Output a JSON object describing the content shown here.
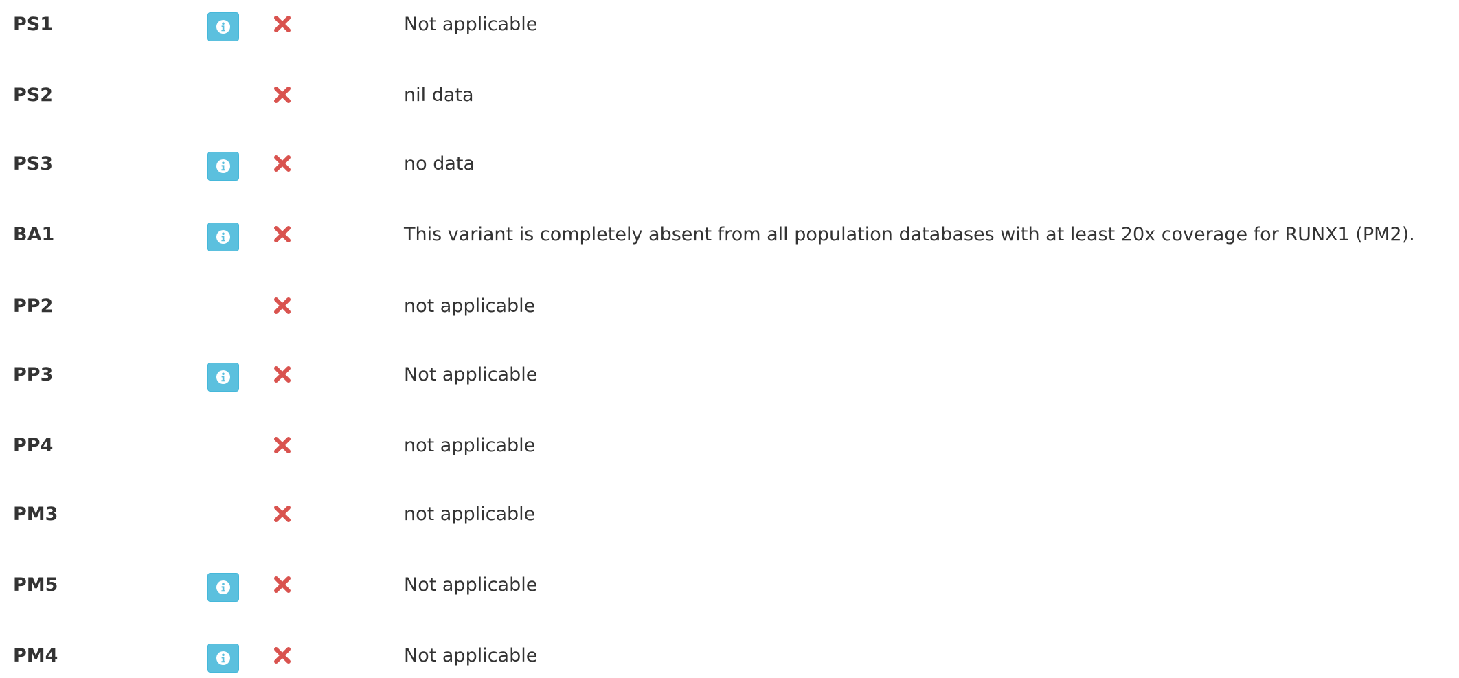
{
  "colors": {
    "text": "#333333",
    "info_button_bg": "#5bc0de",
    "info_button_border": "#46b8da",
    "status_fail": "#d9534f"
  },
  "icons": {
    "info": "info-icon",
    "status": "cross-icon"
  },
  "criteria": [
    {
      "code": "PS1",
      "has_info": true,
      "status": "not-met",
      "comment": "Not applicable"
    },
    {
      "code": "PS2",
      "has_info": false,
      "status": "not-met",
      "comment": "nil data"
    },
    {
      "code": "PS3",
      "has_info": true,
      "status": "not-met",
      "comment": "no data"
    },
    {
      "code": "BA1",
      "has_info": true,
      "status": "not-met",
      "comment": "This variant is completely absent from all population databases with at least 20x coverage for RUNX1 (PM2)."
    },
    {
      "code": "PP2",
      "has_info": false,
      "status": "not-met",
      "comment": "not applicable"
    },
    {
      "code": "PP3",
      "has_info": true,
      "status": "not-met",
      "comment": "Not applicable"
    },
    {
      "code": "PP4",
      "has_info": false,
      "status": "not-met",
      "comment": "not applicable"
    },
    {
      "code": "PM3",
      "has_info": false,
      "status": "not-met",
      "comment": "not applicable"
    },
    {
      "code": "PM5",
      "has_info": true,
      "status": "not-met",
      "comment": "Not applicable"
    },
    {
      "code": "PM4",
      "has_info": true,
      "status": "not-met",
      "comment": "Not applicable"
    }
  ]
}
